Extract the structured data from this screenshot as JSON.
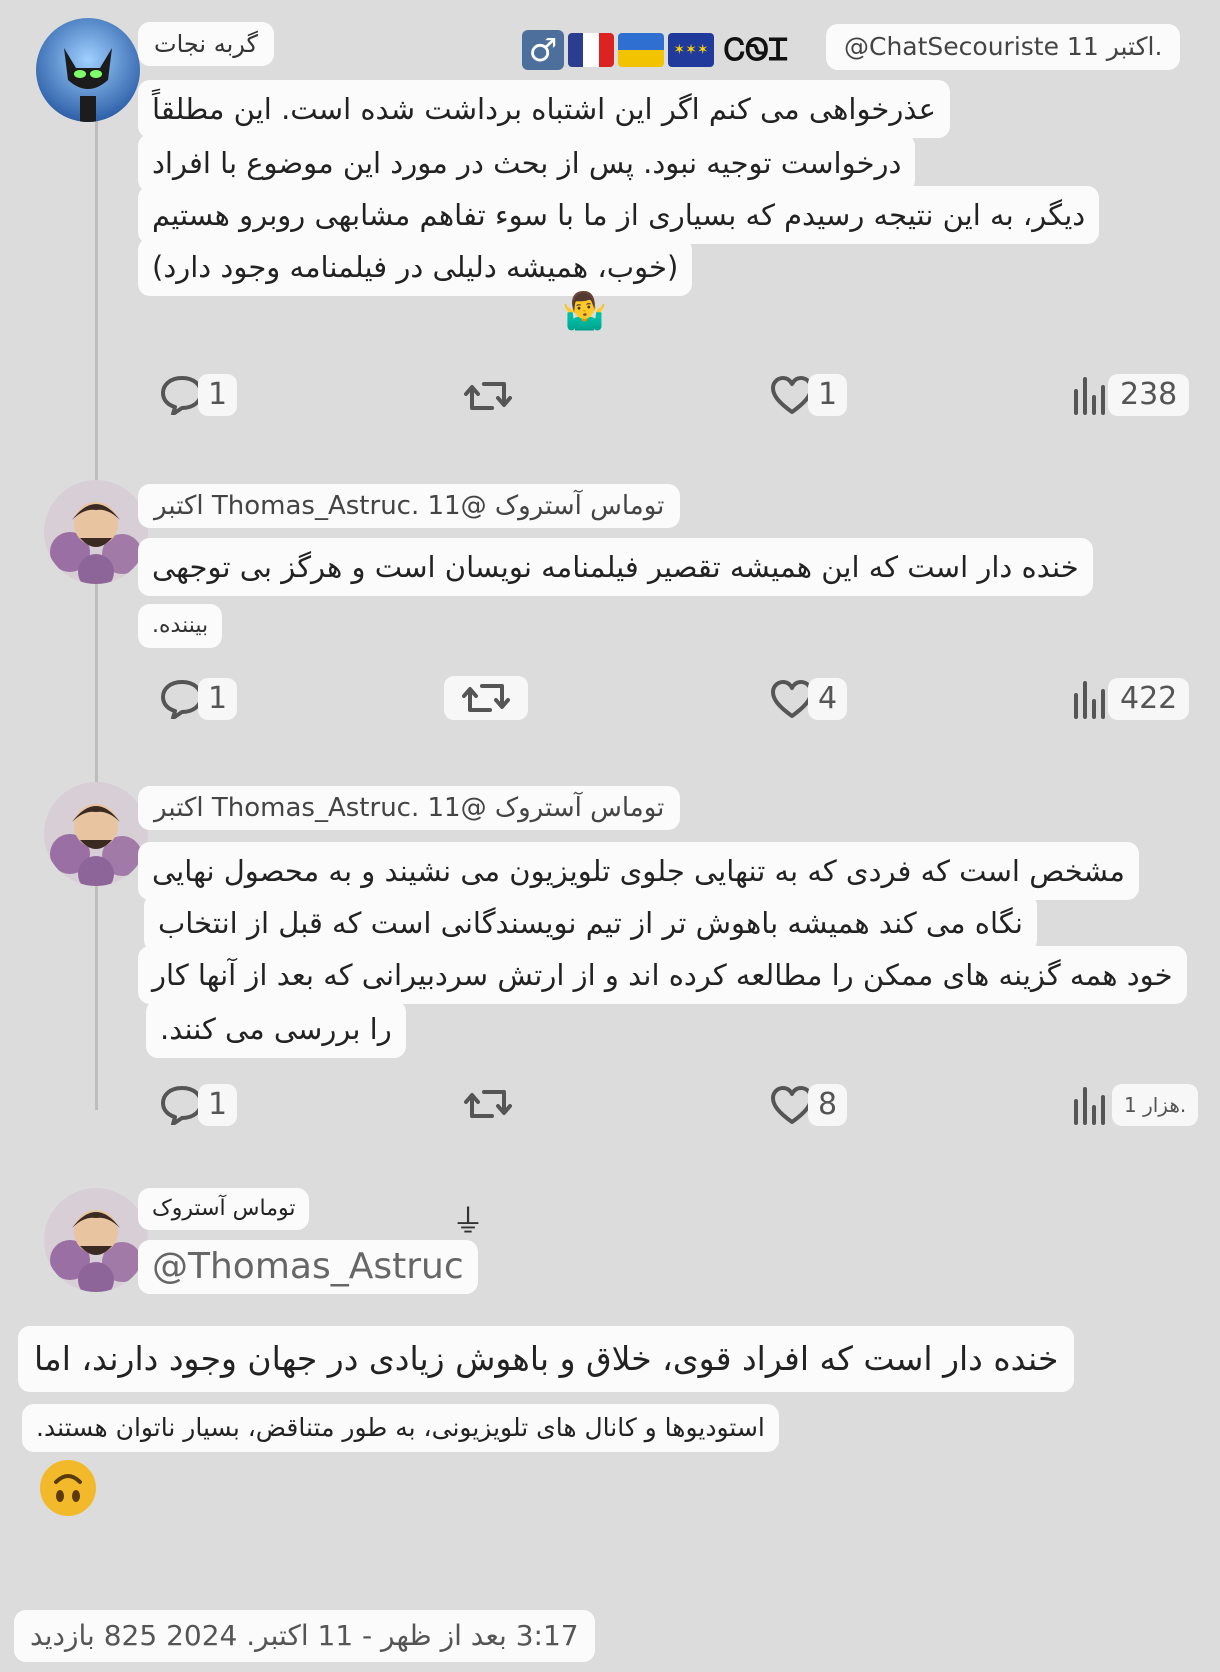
{
  "post1": {
    "display_name": "گربه نجات",
    "handle_date": "@ChatSecouriste 11 اکتبر.",
    "name_decoration": "ᏟᏫᏆ",
    "lines": [
      "عذرخواهی می کنم اگر این اشتباه برداشت شده است. این مطلقاً",
      "درخواست توجیه نبود. پس از بحث در مورد این موضوع با افراد",
      "دیگر، به این نتیجه رسیدم که بسیاری از ما با سوء تفاهم مشابهی روبرو هستیم",
      "(خوب، همیشه دلیلی در فیلمنامه وجود دارد)"
    ],
    "emoji": "🤷‍♂️",
    "replies": "1",
    "likes": "1",
    "views": "238"
  },
  "post2": {
    "header": "توماس آستروک @Thomas_Astruc. 11 اکتبر",
    "lines": [
      "خنده دار است که این همیشه تقصیر فیلمنامه نویسان است و هرگز بی توجهی",
      "بیننده."
    ],
    "replies": "1",
    "likes": "4",
    "views": "422"
  },
  "post3": {
    "header": "توماس آستروک @Thomas_Astruc. 11 اکتبر",
    "lines": [
      "مشخص است که فردی که به تنهایی جلوی تلویزیون می نشیند و به محصول نهایی",
      "نگاه می کند همیشه باهوش تر از تیم نویسندگانی است که قبل از انتخاب",
      "خود همه گزینه های ممکن را مطالعه کرده اند و از ارتش سردبیرانی که بعد از آنها کار",
      "را بررسی می کنند."
    ],
    "replies": "1",
    "likes": "8",
    "views": "1 هزار."
  },
  "main_post": {
    "display_name": "توماس آستروک",
    "handle": "@Thomas_Astruc",
    "badge": "⏚",
    "line1": "خنده دار است که افراد قوی، خلاق و باهوش زیادی در جهان وجود دارند، اما",
    "line2": "استودیوها و کانال های تلویزیونی، به طور متناقض، بسیار ناتوان هستند.",
    "emoji": "🙃",
    "footer": "3:17 بعد از ظهر - 11 اکتبر. 2024 825 بازدید"
  },
  "icons": [
    "reply-icon",
    "retweet-icon",
    "like-icon",
    "views-icon",
    "male-sign-icon"
  ],
  "colors": {
    "background": "#dcdcdc",
    "bubble": "#fbfbfb",
    "icon": "#555555"
  }
}
